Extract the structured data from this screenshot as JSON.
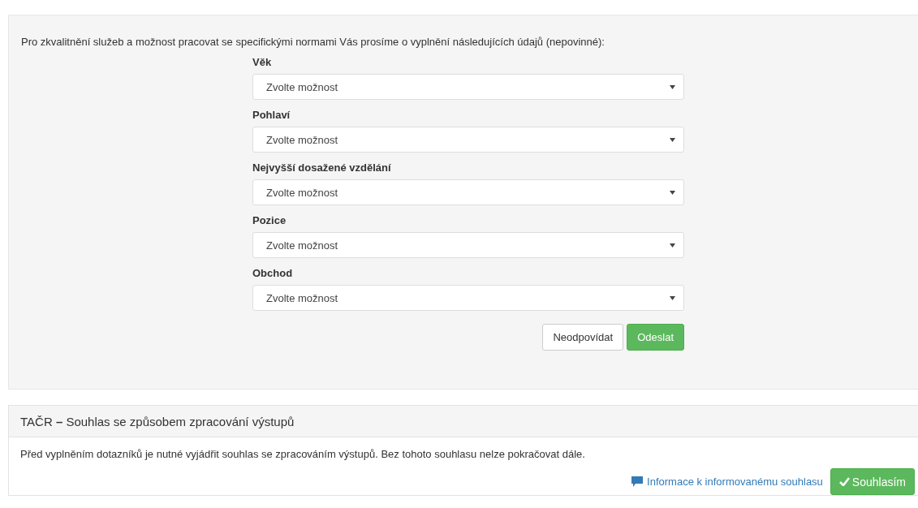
{
  "survey": {
    "intro": "Pro zkvalitnění služeb a možnost pracovat se specifickými normami Vás prosíme o vyplnění následujících údajů (nepovinné):",
    "fields": [
      {
        "label": "Věk",
        "placeholder": "Zvolte možnost"
      },
      {
        "label": "Pohlaví",
        "placeholder": "Zvolte možnost"
      },
      {
        "label": "Nejvyšší dosažené vzdělání",
        "placeholder": "Zvolte možnost"
      },
      {
        "label": "Pozice",
        "placeholder": "Zvolte možnost"
      },
      {
        "label": "Obchod",
        "placeholder": "Zvolte možnost"
      }
    ],
    "buttons": [
      {
        "label": "Neodpovídat",
        "kind": "default"
      },
      {
        "label": "Odeslat",
        "kind": "success"
      }
    ]
  },
  "consent": {
    "title": "TAČR **–** Souhlas se způsobem zpracování výstupů",
    "text": "Před vyplněním dotazníků je nutné vyjádřit souhlas se zpracováním výstupů. Bez tohoto souhlasu nelze pokračovat dále.",
    "link": "Informace k informovanému souhlasu",
    "button": "Souhlasím"
  }
}
